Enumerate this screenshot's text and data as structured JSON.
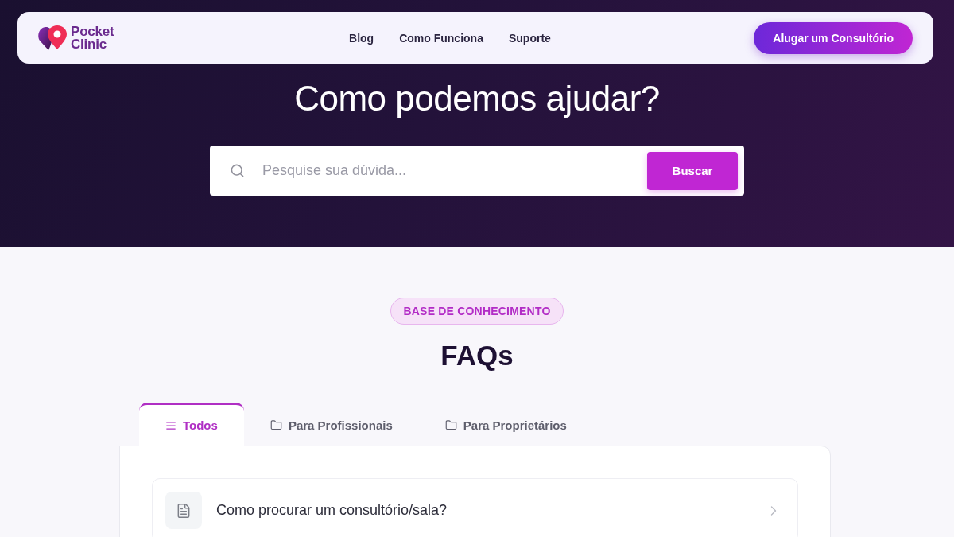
{
  "brand": {
    "name_lines": [
      "Pocket",
      "Clinic"
    ]
  },
  "nav": {
    "links": [
      "Blog",
      "Como Funciona",
      "Suporte"
    ],
    "cta": "Alugar um Consultório"
  },
  "hero": {
    "title": "Como podemos ajudar?",
    "search": {
      "placeholder": "Pesquise sua dúvida...",
      "button": "Buscar"
    }
  },
  "faq_section": {
    "tag": "BASE DE CONHECIMENTO",
    "title": "FAQs",
    "tabs": [
      {
        "label": "Todos",
        "kind": "all",
        "selected": true
      },
      {
        "label": "Para Profissionais",
        "kind": "category",
        "selected": false
      },
      {
        "label": "Para Proprietários",
        "kind": "category",
        "selected": false
      }
    ],
    "items": [
      {
        "question": "Como procurar um consultório/sala?"
      }
    ]
  }
}
